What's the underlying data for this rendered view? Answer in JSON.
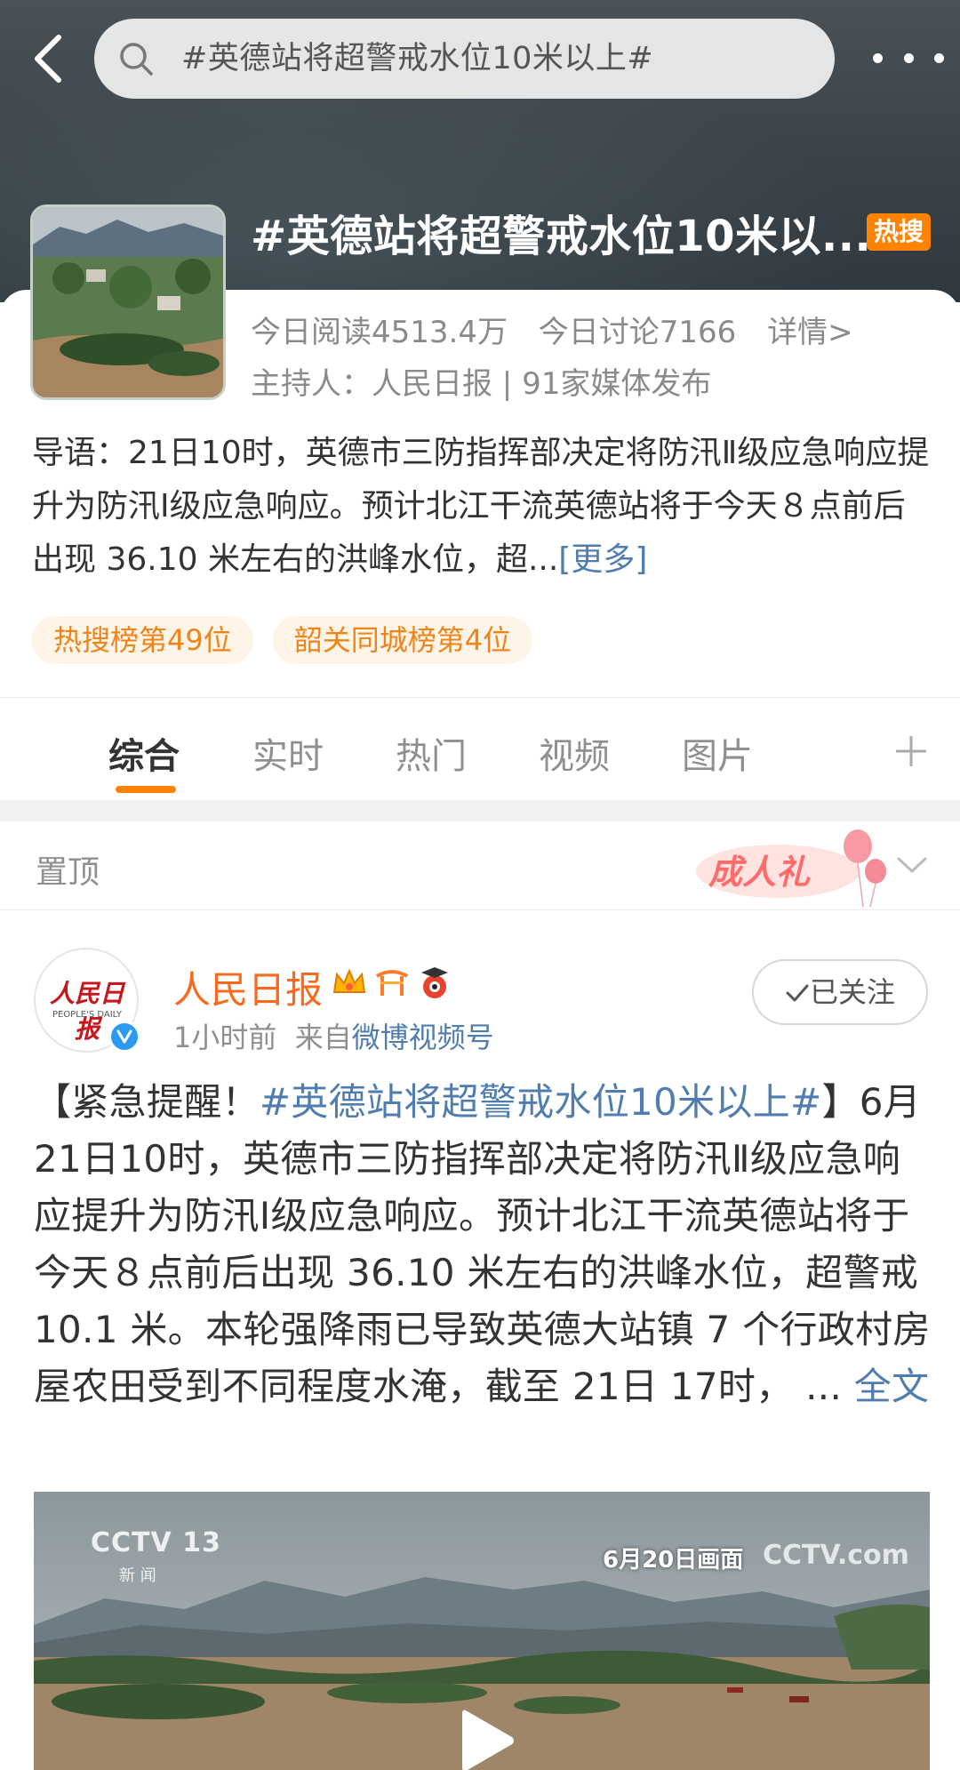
{
  "search": {
    "query": "#英德站将超警戒水位10米以上#"
  },
  "topic": {
    "title": "#英德站将超警戒水位10米以...",
    "badge": "热搜",
    "read_today": "今日阅读4513.4万",
    "discuss_today": "今日讨论7166",
    "details_link": "详情>",
    "hosts": "主持人：人民日报 | 91家媒体发布"
  },
  "intro": {
    "text": "导语：21日10时，英德市三防指挥部决定将防汛Ⅱ级应急响应提升为防汛Ⅰ级应急响应。预计北江干流英德站将于今天８点前后出现 36.10 米左右的洪峰水位，超...",
    "more": "[更多]"
  },
  "tags": [
    "热搜榜第49位",
    "韶关同城榜第4位"
  ],
  "tabs": [
    "综合",
    "实时",
    "热门",
    "视频",
    "图片"
  ],
  "pinned": {
    "label": "置顶",
    "badge_text": "成人礼"
  },
  "post": {
    "author": "人民日报",
    "avatar_text_cn": "人民日报",
    "avatar_text_en": "PEOPLE'S DAILY",
    "time": "1小时前",
    "source_prefix": "来自",
    "source": "微博视频号",
    "follow_label": "已关注",
    "body_prefix": "【紧急提醒！",
    "body_hashtag": "#英德站将超警戒水位10米以上#",
    "body_text": "】6月21日10时，英德市三防指挥部决定将防汛Ⅱ级应急响应提升为防汛Ⅰ级应急响应。预计北江干流英德站将于今天８点前后出现 36.10 米左右的洪峰水位，超警戒 10.1 米。本轮强降雨已导致英德大站镇 7 个行政村房屋农田受到不同程度水淹，截至 21日 17时， ...",
    "full_text_link": "全文"
  },
  "video": {
    "channel_logo": "CCTV 13",
    "channel_sub": "新 闻",
    "caption": "6月20日画面",
    "watermark": "CCTV.com"
  },
  "colors": {
    "accent": "#ff8200",
    "link": "#507daf",
    "author": "#f86a1e",
    "tag_bg": "#fff4e8"
  }
}
